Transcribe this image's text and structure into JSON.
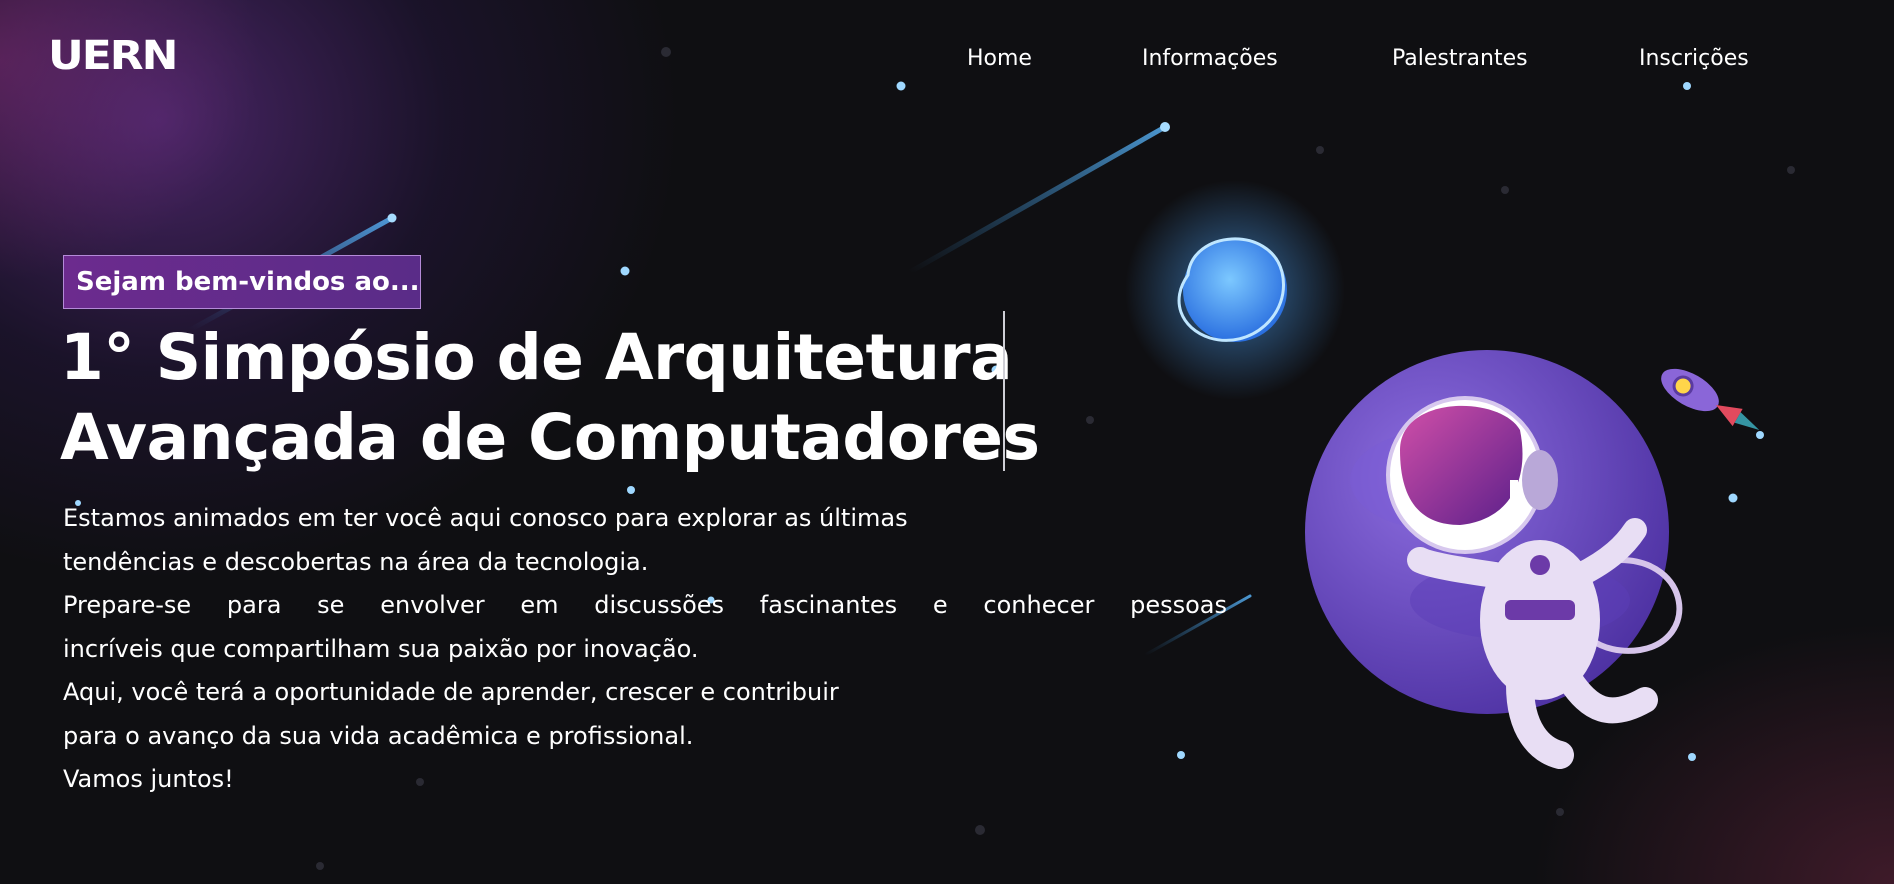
{
  "brand": {
    "logo_text": "UERN"
  },
  "nav": {
    "items": [
      {
        "label": "Home"
      },
      {
        "label": "Informações"
      },
      {
        "label": "Palestrantes"
      },
      {
        "label": "Inscrições"
      }
    ]
  },
  "hero": {
    "badge": "Sejam bem-vindos ao...",
    "title_line1": "1° Simpósio de Arquitetura",
    "title_line2": "Avançada de Computadores",
    "paragraphs": [
      "Estamos animados em ter você aqui conosco para explorar as últimas",
      "tendências e descobertas na área da tecnologia.",
      "Prepare-se para se envolver em discussões fascinantes e conhecer pessoas",
      "incríveis que compartilham sua paixão por inovação.",
      "Aqui, você terá a oportunidade de aprender, crescer e contribuir",
      "para o avanço da sua vida acadêmica e profissional.",
      "Vamos juntos!"
    ]
  },
  "colors": {
    "background": "#0f0f12",
    "accent_purple": "#6c2b8e",
    "planet_purple": "#6a4bc4",
    "glow_blue": "#4fa8ff",
    "text": "#ffffff"
  },
  "icons": [
    "shooting-star-icon",
    "blue-planet-icon",
    "astronaut-icon",
    "rocket-icon",
    "star-dot-icon"
  ]
}
